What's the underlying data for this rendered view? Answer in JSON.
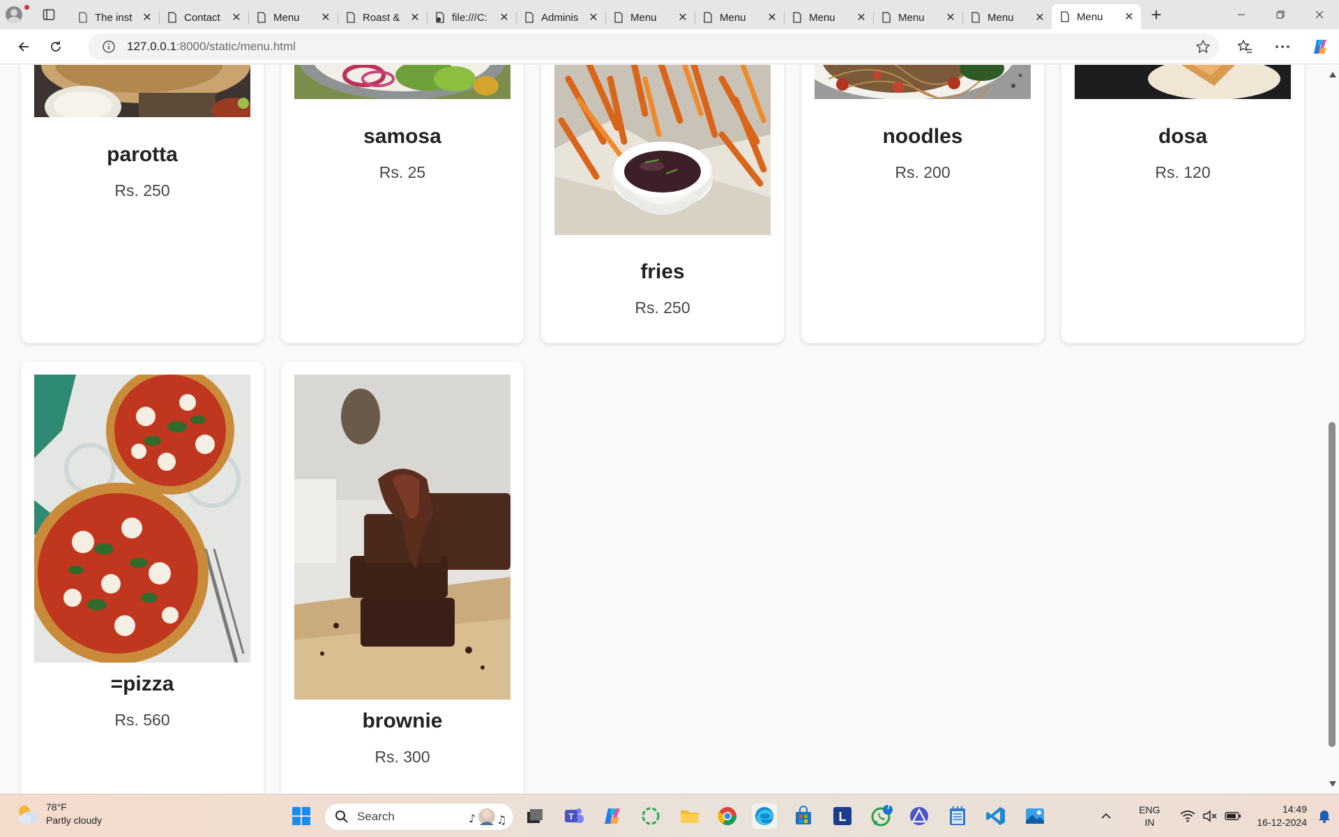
{
  "browser": {
    "tabs": [
      {
        "label": "The inst",
        "active": false
      },
      {
        "label": "Contact",
        "active": false
      },
      {
        "label": "Menu",
        "active": false
      },
      {
        "label": "Roast &",
        "active": false
      },
      {
        "label": "file:///C:",
        "active": false
      },
      {
        "label": "Adminis",
        "active": false
      },
      {
        "label": "Menu",
        "active": false
      },
      {
        "label": "Menu",
        "active": false
      },
      {
        "label": "Menu",
        "active": false
      },
      {
        "label": "Menu",
        "active": false
      },
      {
        "label": "Menu",
        "active": false
      },
      {
        "label": "Menu",
        "active": true
      }
    ],
    "url_host": "127.0.0.1",
    "url_path": ":8000/static/menu.html"
  },
  "menu": {
    "items": [
      {
        "name": "parotta",
        "price": "Rs. 250"
      },
      {
        "name": "samosa",
        "price": "Rs. 25"
      },
      {
        "name": "fries",
        "price": "Rs. 250"
      },
      {
        "name": "noodles",
        "price": "Rs. 200"
      },
      {
        "name": "dosa",
        "price": "Rs. 120"
      },
      {
        "name": "=pizza",
        "price": "Rs. 560"
      },
      {
        "name": "brownie",
        "price": "Rs. 300"
      }
    ]
  },
  "taskbar": {
    "weather_temp": "78°F",
    "weather_desc": "Partly cloudy",
    "search_placeholder": "Search",
    "whatsapp_badge": "7",
    "lang_top": "ENG",
    "lang_bottom": "IN",
    "time": "14:49",
    "date": "16-12-2024"
  },
  "colors": {
    "accent": "#0078d4",
    "card_bg": "#ffffff",
    "page_bg": "#f9f9f9"
  }
}
